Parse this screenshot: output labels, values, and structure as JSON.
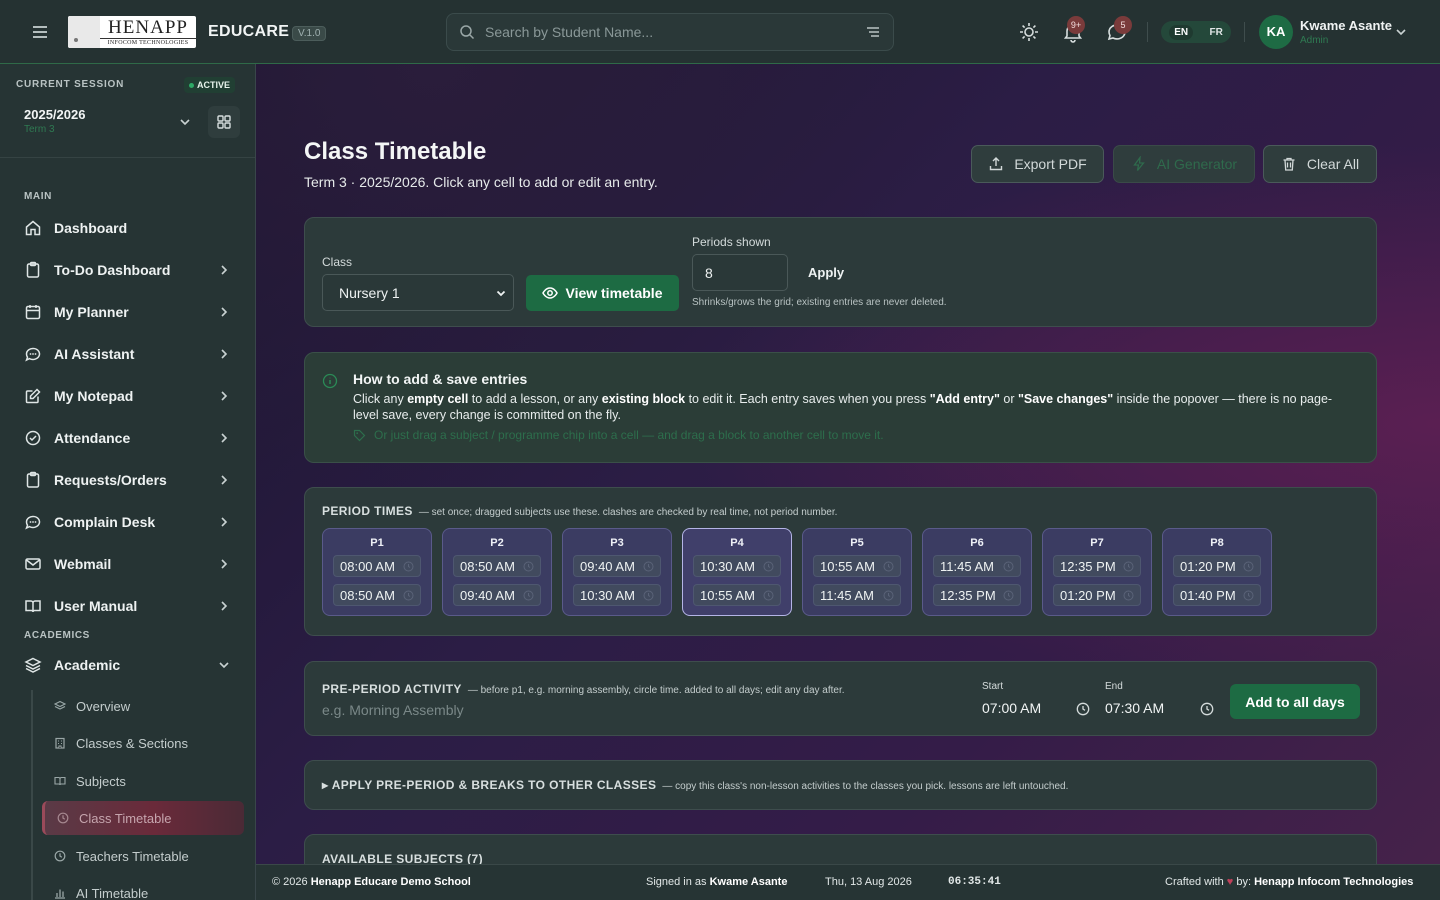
{
  "header": {
    "logo_text": "HENAPP",
    "logo_subtext": "INFOCOM TECHNOLOGIES",
    "brand": "EDUCARE",
    "version": "V.1.0",
    "search_placeholder": "Search by Student Name...",
    "notifications_count": "9+",
    "messages_count": "5",
    "lang_en": "EN",
    "lang_fr": "FR",
    "user_initials": "KA",
    "user_name": "Kwame Asante",
    "user_role": "Admin"
  },
  "sidebar": {
    "session_label": "CURRENT SESSION",
    "session_status": "ACTIVE",
    "session_year": "2025/2026",
    "session_term": "Term 3",
    "main_label": "MAIN",
    "academics_label": "ACADEMICS",
    "items": [
      {
        "label": "Dashboard",
        "icon": "home-icon"
      },
      {
        "label": "To-Do Dashboard",
        "icon": "clipboard-icon"
      },
      {
        "label": "My Planner",
        "icon": "calendar-icon"
      },
      {
        "label": "AI Assistant",
        "icon": "chat-icon"
      },
      {
        "label": "My Notepad",
        "icon": "edit-icon"
      },
      {
        "label": "Attendance",
        "icon": "check-circle-icon"
      },
      {
        "label": "Requests/Orders",
        "icon": "clipboard-icon"
      },
      {
        "label": "Complain Desk",
        "icon": "chat-icon"
      },
      {
        "label": "Webmail",
        "icon": "mail-icon"
      },
      {
        "label": "User Manual",
        "icon": "book-icon"
      }
    ],
    "academic": {
      "label": "Academic",
      "icon": "layers-icon"
    },
    "subitems": [
      {
        "label": "Overview"
      },
      {
        "label": "Classes & Sections"
      },
      {
        "label": "Subjects"
      },
      {
        "label": "Class Timetable"
      },
      {
        "label": "Teachers Timetable"
      },
      {
        "label": "AI Timetable"
      }
    ]
  },
  "main": {
    "title": "Class Timetable",
    "subtitle": "Term 3 · 2025/2026. Click any cell to add or edit an entry.",
    "export_pdf": "Export PDF",
    "ai_generator": "AI Generator",
    "clear_all": "Clear All",
    "class_label": "Class",
    "class_value": "Nursery 1",
    "view_timetable": "View timetable",
    "periods_label": "Periods shown",
    "periods_value": "8",
    "apply": "Apply",
    "periods_hint": "Shrinks/grows the grid; existing entries are never deleted.",
    "info_title": "How to add & save entries",
    "info_line1_a": "Click any ",
    "info_line1_b": "empty cell",
    "info_line1_c": " to add a lesson, or any ",
    "info_line1_d": "existing block",
    "info_line1_e": " to edit it. Each entry saves when you press ",
    "info_line1_f": "\"Add entry\"",
    "info_line1_g": " or ",
    "info_line1_h": "\"Save changes\"",
    "info_line1_i": " inside the popover — there is no page-level save, every change is committed on the fly.",
    "info_drag": "Or just drag a subject / programme chip into a cell — and drag a block to another cell to move it.",
    "period_times_title": "PERIOD TIMES",
    "period_times_note": "— set once; dragged subjects use these. clashes are checked by real time, not period number.",
    "periods": [
      {
        "label": "P1",
        "start": "08:00 AM",
        "end": "08:50 AM"
      },
      {
        "label": "P2",
        "start": "08:50 AM",
        "end": "09:40 AM"
      },
      {
        "label": "P3",
        "start": "09:40 AM",
        "end": "10:30 AM"
      },
      {
        "label": "P4",
        "start": "10:30 AM",
        "end": "10:55 AM"
      },
      {
        "label": "P5",
        "start": "10:55 AM",
        "end": "11:45 AM"
      },
      {
        "label": "P6",
        "start": "11:45 AM",
        "end": "12:35 PM"
      },
      {
        "label": "P7",
        "start": "12:35 PM",
        "end": "01:20 PM"
      },
      {
        "label": "P8",
        "start": "01:20 PM",
        "end": "01:40 PM"
      }
    ],
    "pre_period_title": "PRE-PERIOD ACTIVITY",
    "pre_period_note": "— before p1, e.g. morning assembly, circle time. added to all days; edit any day after.",
    "pre_period_placeholder": "e.g. Morning Assembly",
    "start_label": "Start",
    "start_value": "07:00 AM",
    "end_label": "End",
    "end_value": "07:30 AM",
    "add_all_days": "Add to all days",
    "apply_title": "▸ APPLY PRE-PERIOD & BREAKS TO OTHER CLASSES",
    "apply_note": "— copy this class's non-lesson activities to the classes you pick. lessons are left untouched.",
    "available_subjects": "AVAILABLE SUBJECTS (7)"
  },
  "footer": {
    "copyright_a": "© 2026 ",
    "copyright_b": "Henapp Educare Demo School",
    "signed_a": "Signed in as ",
    "signed_b": "Kwame Asante",
    "date": "Thu, 13 Aug 2026",
    "time": "06:35:41",
    "crafted_a": "Crafted with ",
    "crafted_heart": "♥",
    "crafted_b": " by: ",
    "crafted_c": "Henapp Infocom Technologies"
  }
}
